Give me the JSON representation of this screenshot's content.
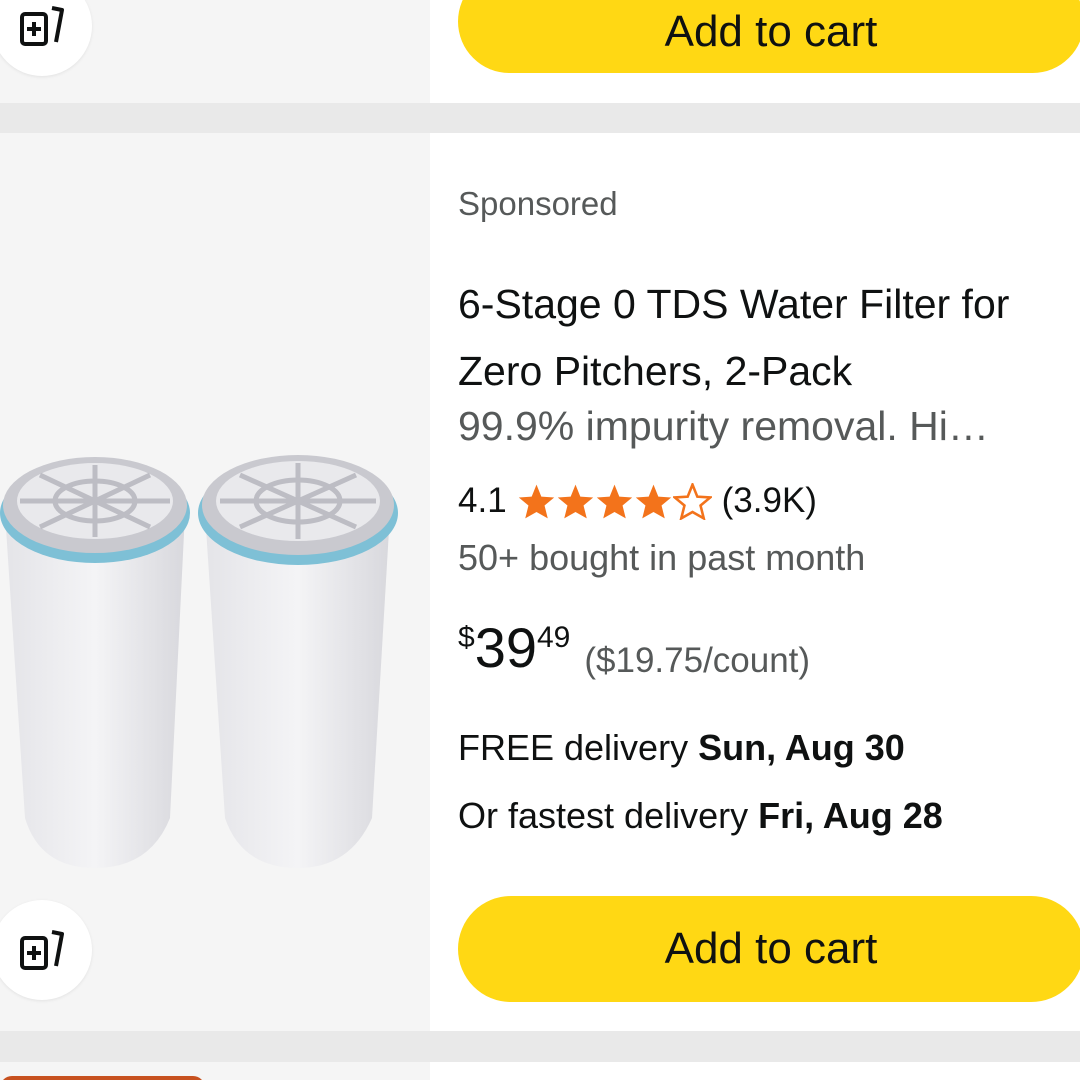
{
  "previous_card": {
    "add_to_cart_label": "Add to cart",
    "compare_icon": "add-to-compare-icon"
  },
  "product": {
    "sponsored_label": "Sponsored",
    "title": "6-Stage 0 TDS Water Filter for Zero Pitchers, 2-Pack",
    "description": "99.9% impurity removal. Hi…",
    "rating": {
      "value": "4.1",
      "stars": 4.1,
      "max_stars": 5,
      "count": "(3.9K)"
    },
    "bought_text": "50+ bought in past month",
    "price": {
      "symbol": "$",
      "whole": "39",
      "fraction": "49",
      "unit_price": "($19.75/count)"
    },
    "delivery": {
      "free_prefix": "FREE delivery ",
      "free_date": "Sun, Aug 30",
      "fastest_prefix": "Or fastest delivery ",
      "fastest_date": "Fri, Aug 28"
    },
    "add_to_cart_label": "Add to cart",
    "compare_icon": "add-to-compare-icon"
  },
  "colors": {
    "add_to_cart_bg": "#ffd814",
    "star_color": "#f3731b",
    "secondary_text": "#565959",
    "image_bg": "#f5f5f5"
  }
}
